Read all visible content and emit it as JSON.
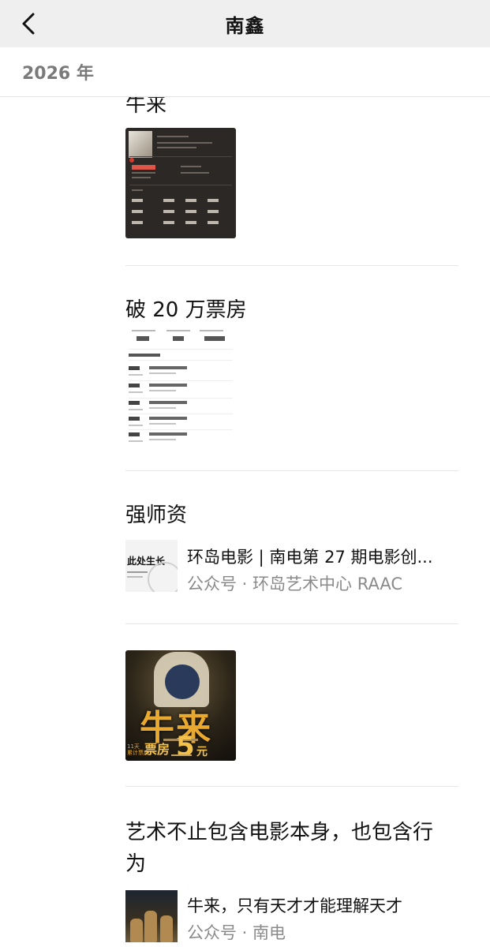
{
  "nav": {
    "title": "南鑫",
    "back_icon": "chevron-left-icon"
  },
  "year_bar": {
    "year": "2026 年"
  },
  "sections": {
    "s1": {
      "title": "牛来"
    },
    "s2": {
      "title": "破 20 万票房"
    },
    "s3": {
      "title": "强师资"
    },
    "s5": {
      "title_line1": "艺术不止包含电影本身，也包含行",
      "title_line2": "为"
    }
  },
  "thumb2": {
    "nums": [
      "70",
      "17",
      "39",
      "16"
    ]
  },
  "article1": {
    "thumb_text": "此处生长",
    "title": "环岛电影 | 南电第 27 期电影创...",
    "source": "公众号 · 环岛艺术中心 RAAC"
  },
  "poster": {
    "title": "牛来",
    "box_label": "票房",
    "box_value": "5",
    "box_unit": "元",
    "side_text": "11天\n累计票房"
  },
  "article2": {
    "title": "牛来，只有天才才能理解天才",
    "source": "公众号 · 南电"
  }
}
